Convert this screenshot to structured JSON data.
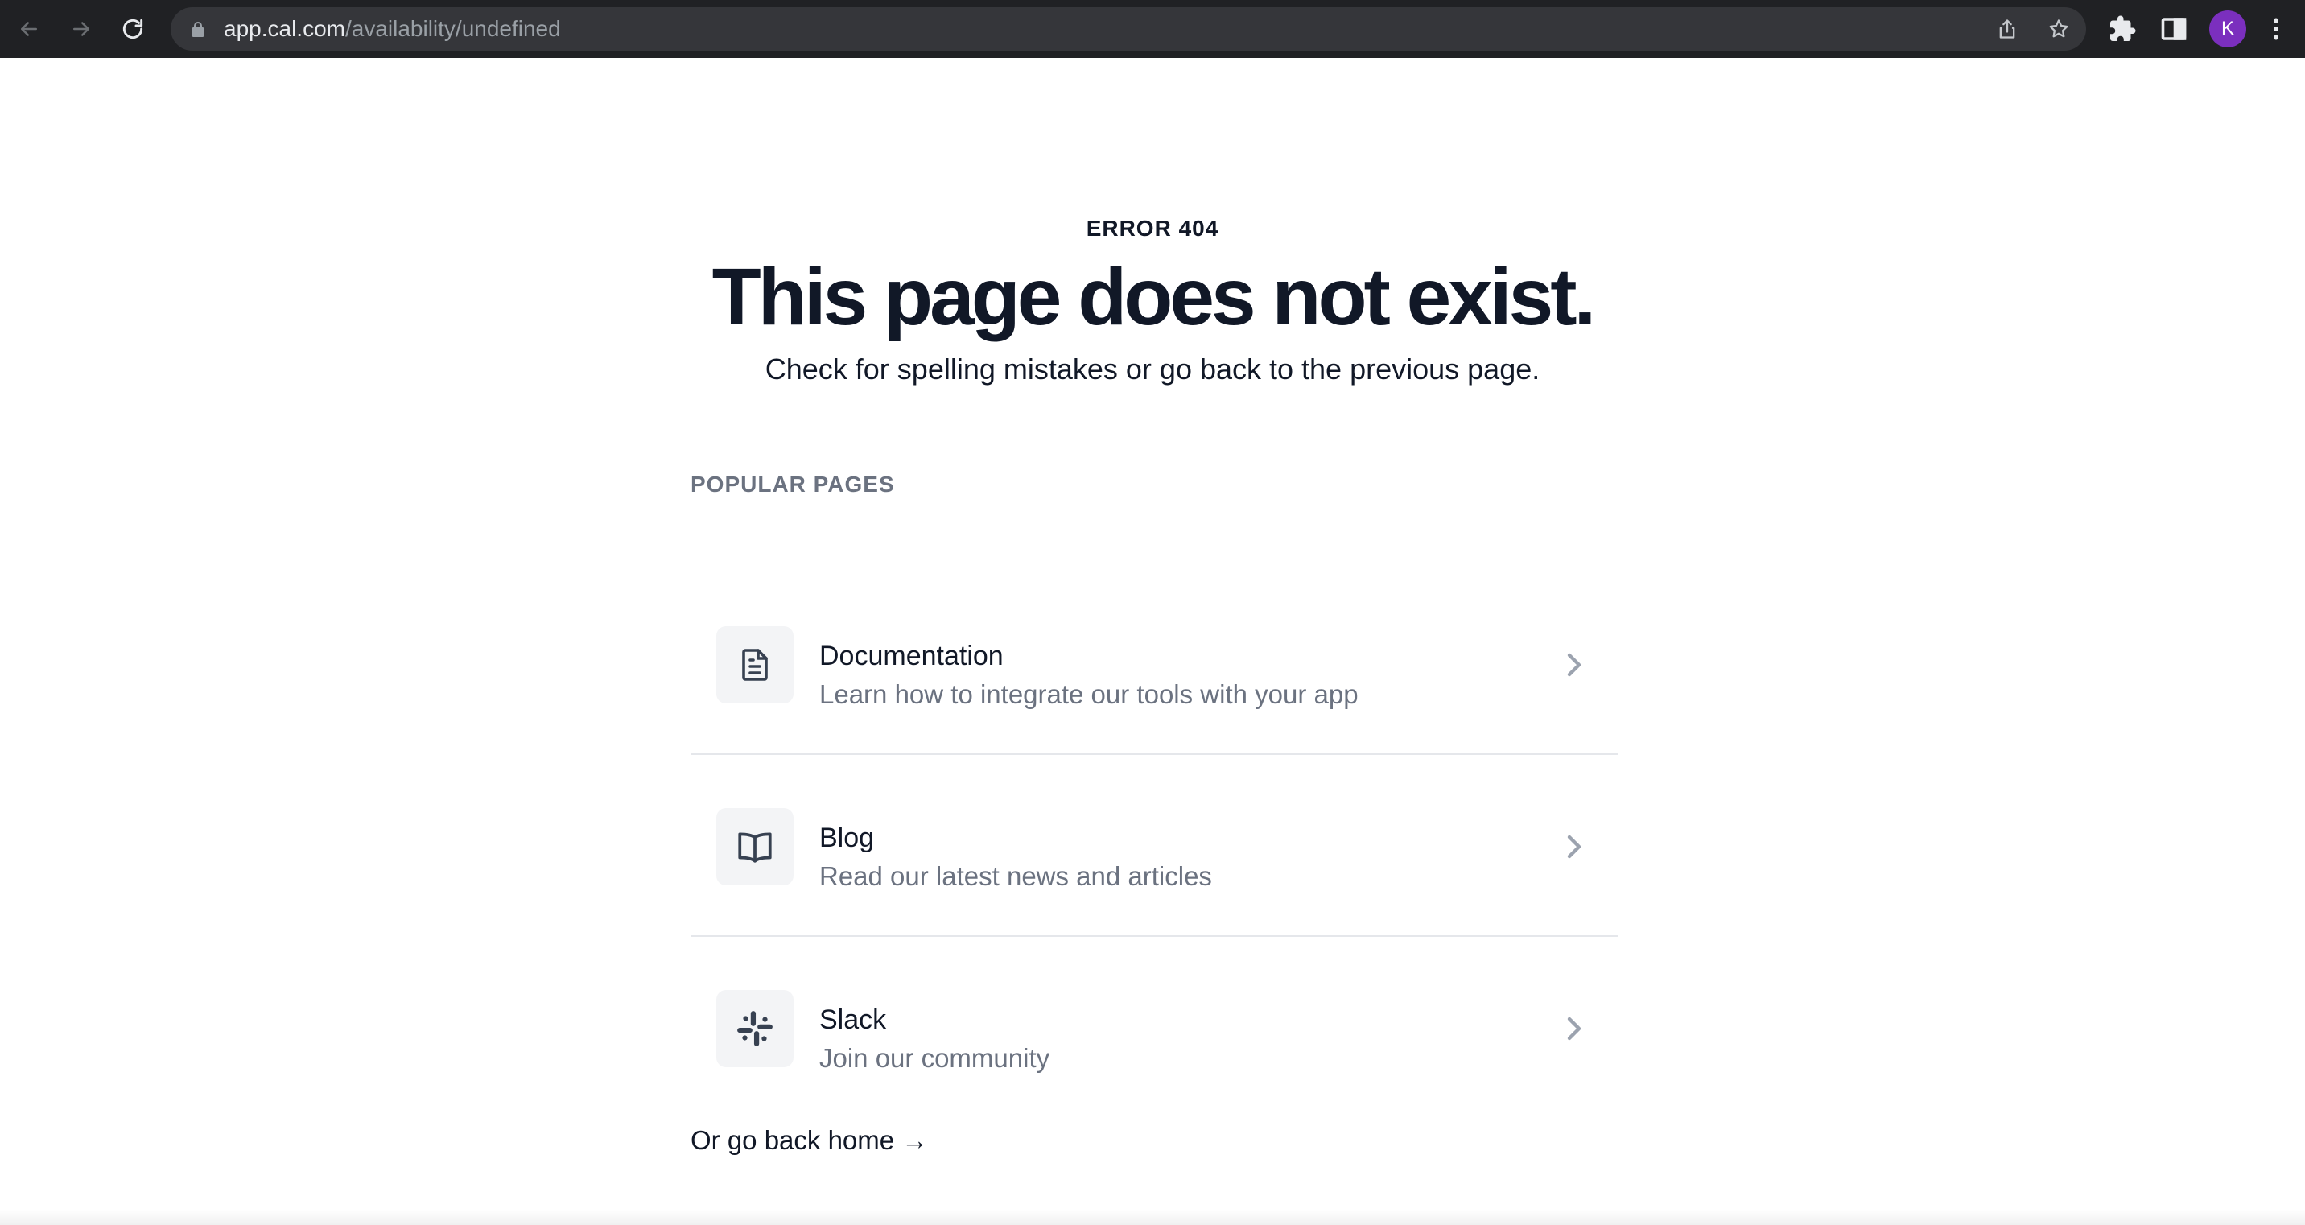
{
  "browser": {
    "url_host": "app.cal.com",
    "url_path": "/availability/undefined",
    "profile_initial": "K",
    "icons": [
      "back-arrow-icon",
      "forward-arrow-icon",
      "reload-icon",
      "lock-icon",
      "share-icon",
      "star-icon",
      "extensions-icon",
      "side-panel-icon",
      "menu-dots-icon"
    ],
    "colors": {
      "toolbar": "#202124",
      "omnibox": "#35363a",
      "avatar": "#7b2fbe"
    }
  },
  "error": {
    "code": "ERROR 404",
    "title": "This page does not exist.",
    "subtitle": "Check for spelling mistakes or go back to the previous page."
  },
  "popular": {
    "heading": "POPULAR PAGES",
    "items": [
      {
        "title": "Documentation",
        "description": "Learn how to integrate our tools with your app",
        "icon": "document-icon"
      },
      {
        "title": "Blog",
        "description": "Read our latest news and articles",
        "icon": "book-open-icon"
      },
      {
        "title": "Slack",
        "description": "Join our community",
        "icon": "slack-icon"
      }
    ]
  },
  "footer": {
    "home_link": "Or go back home →"
  }
}
